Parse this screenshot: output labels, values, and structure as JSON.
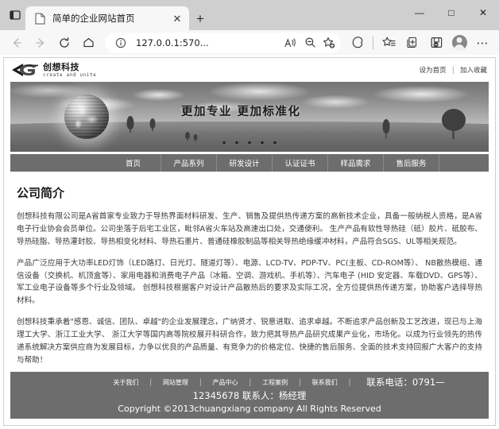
{
  "browser": {
    "window_controls": {
      "minimize": "—",
      "maximize": "□",
      "close": "✕"
    },
    "tab": {
      "title": "简单的企业网站首页",
      "close_label": "✕"
    },
    "new_tab_label": "+",
    "toolbar": {
      "back": "←",
      "forward": "→",
      "refresh": "↻",
      "home": "⌂",
      "url": "127.0.0.1:570...",
      "more_label": "⋯"
    }
  },
  "site": {
    "logo": {
      "name_cn": "创想科技",
      "name_en": "create and unite"
    },
    "header_links": [
      {
        "label": "设为首页"
      },
      {
        "label": "加入收藏"
      }
    ],
    "banner": {
      "slogan": "更加专业  更加标准化",
      "dot_count": 5
    },
    "nav": [
      {
        "label": "首页"
      },
      {
        "label": "产品系列"
      },
      {
        "label": "研发设计"
      },
      {
        "label": "认证证书"
      },
      {
        "label": "样品需求"
      },
      {
        "label": "售后服务"
      }
    ],
    "content": {
      "section_title": "公司简介",
      "paragraphs": [
        "创想科技有限公司是A省首家专业致力于导热界面材料研发、生产、销售及提供热传递方案的高新技术企业，具备一般纳税人资格，是A省电子行业协会会员单位。公司坐落于后宅工业区，毗邻A省火车站及高速出口处，交通便利。 生产产品有软性导热硅（砥）胶片、砥胶布、导热硅脂、导热灌封胶、导热相变化材料、导热石墨片、普通硅橡胶制品等相关导热绝缘缓冲材料，产品符合SGS、UL等相关规范。",
        "产品广泛应用于大功率LED灯饰（LED路灯、日光灯、隧道灯等）、电源、LCD-TV、PDP-TV、PC(主板、CD-ROM等）、 NB散热模组、通信设备（交换机、机顶盒等）、家用电器和消费电子产品（冰箱、空调、游戏机、手机等）、汽车电子 (HID 安定器、车载DVD、GPS等）、军工业电子设备等多个行业及领域。 创想科技根据客户对设计产品散热后的要求及实际工况，全方位提供热传递方案，协助客户选择导热材料。",
        "创想科技秉承着\"感恩、诚信、团队、卓越\"的企业发展理念，广纳贤才、锐意进取、追求卓越。不断追求产品创新及工艺改进，现已与上海理工大学、浙江工业大学、 浙江大学等国内高等院校展开科研合作，致力把其导热产品研究成果产业化，市场化。以成为行业领先的热传递系统解决方案供应商为发展目标，力争以优良的产品质量、有竞争力的价格定位、快捷的售后服务、全面的技术支持回报广大客户的支持与帮助！"
      ]
    },
    "footer": {
      "links": [
        {
          "label": "关于我们"
        },
        {
          "label": "网站管理"
        },
        {
          "label": "产品中心"
        },
        {
          "label": "工程案例"
        },
        {
          "label": "联系我们"
        }
      ],
      "phone_label": "联系电话：0791—",
      "contact_line": "12345678  联系人：杨经理",
      "copyright": "Copyright ©2013chuangxiang company All Rights Reserved"
    }
  },
  "colors": {
    "nav_bg": "#6d6d6d",
    "footer_bg": "#6d6d6d",
    "text": "#3a3a3a",
    "title": "#1a1a1a"
  }
}
